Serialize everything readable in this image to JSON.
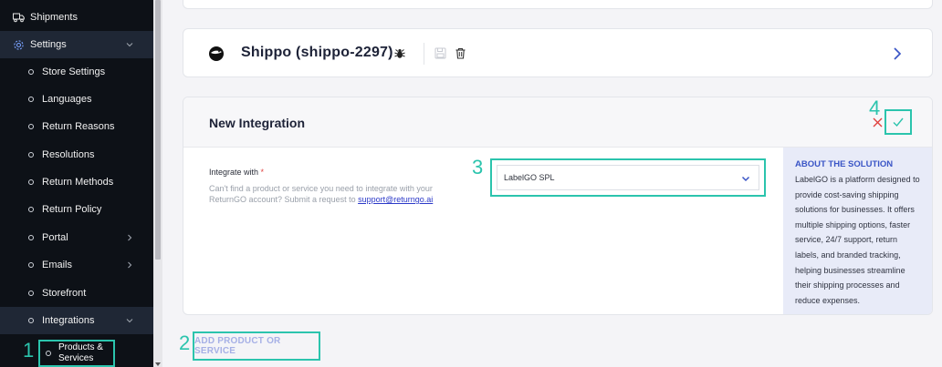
{
  "sidebar": {
    "top_items": [
      {
        "label": "Shipments",
        "icon": "truck-icon"
      },
      {
        "label": "Settings",
        "icon": "gear-icon"
      }
    ],
    "sub_items": [
      {
        "label": "Store Settings"
      },
      {
        "label": "Languages"
      },
      {
        "label": "Return Reasons"
      },
      {
        "label": "Resolutions"
      },
      {
        "label": "Return Methods"
      },
      {
        "label": "Return Policy"
      },
      {
        "label": "Portal"
      },
      {
        "label": "Emails"
      },
      {
        "label": "Storefront"
      },
      {
        "label": "Integrations"
      }
    ],
    "leaf_item": {
      "label": "Products & Services"
    }
  },
  "shippo_card": {
    "title": "Shippo (shippo-2297)"
  },
  "new_integration": {
    "title": "New Integration",
    "integrate_label": "Integrate with",
    "required_mark": "*",
    "help_text": "Can't find a product or service you need to integrate with your ReturnGO account? Submit a request to",
    "help_link": "support@returngo.ai",
    "selected_value": "LabelGO SPL",
    "about_title": "ABOUT THE SOLUTION",
    "about_text": "LabelGO is a platform designed to provide cost-saving shipping solutions for businesses. It offers multiple shipping options, faster service, 24/7 support, return labels, and branded tracking, helping businesses streamline their shipping processes and reduce expenses."
  },
  "add_button": {
    "label": "ADD PRODUCT OR SERVICE"
  },
  "annotations": [
    "1",
    "2",
    "3",
    "4"
  ],
  "colors": {
    "sidebar_bg": "#0d1117",
    "accent_teal": "#2bc4ad",
    "link_blue": "#2b39c8",
    "about_bg": "#e8ebf8",
    "cancel_red": "#e0413f"
  }
}
